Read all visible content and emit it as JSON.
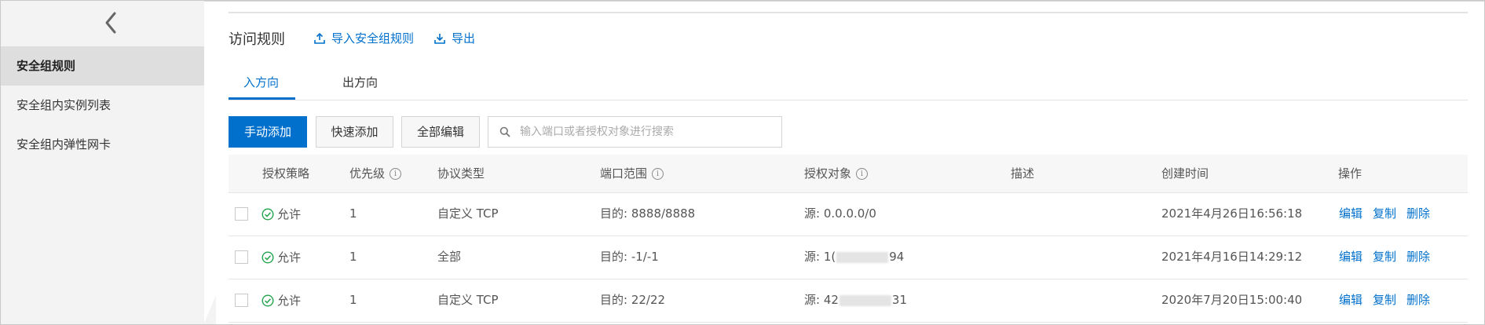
{
  "sidebar": {
    "items": [
      {
        "label": "安全组规则",
        "active": true
      },
      {
        "label": "安全组内实例列表",
        "active": false
      },
      {
        "label": "安全组内弹性网卡",
        "active": false
      }
    ]
  },
  "header": {
    "title": "访问规则",
    "import_label": "导入安全组规则",
    "export_label": "导出"
  },
  "tabs": [
    {
      "label": "入方向",
      "active": true
    },
    {
      "label": "出方向",
      "active": false
    }
  ],
  "toolbar": {
    "manual_add": "手动添加",
    "quick_add": "快速添加",
    "edit_all": "全部编辑",
    "search_placeholder": "输入端口或者授权对象进行搜索"
  },
  "table": {
    "columns": [
      "授权策略",
      "优先级",
      "协议类型",
      "端口范围",
      "授权对象",
      "描述",
      "创建时间",
      "操作"
    ],
    "rows": [
      {
        "policy": "允许",
        "priority": "1",
        "protocol": "自定义 TCP",
        "port": "目的: 8888/8888",
        "source_prefix": "源: 0.0.0.0/0",
        "source_suffix": "",
        "desc": "",
        "created": "2021年4月26日16:56:18"
      },
      {
        "policy": "允许",
        "priority": "1",
        "protocol": "全部",
        "port": "目的: -1/-1",
        "source_prefix": "源: 1(",
        "source_suffix": "94",
        "desc": "",
        "created": "2021年4月16日14:29:12"
      },
      {
        "policy": "允许",
        "priority": "1",
        "protocol": "自定义 TCP",
        "port": "目的: 22/22",
        "source_prefix": "源: 42",
        "source_suffix": "31",
        "desc": "",
        "created": "2020年7月20日15:00:40"
      }
    ],
    "ops": {
      "edit": "编辑",
      "copy": "复制",
      "delete": "删除"
    }
  },
  "icons": {
    "collapse": "chevron-left-icon",
    "import": "upload-icon",
    "export": "download-icon",
    "search": "search-icon",
    "allow": "check-circle-icon",
    "info": "info-icon"
  },
  "colors": {
    "accent": "#0070cc",
    "allow_green": "#22a34a"
  }
}
